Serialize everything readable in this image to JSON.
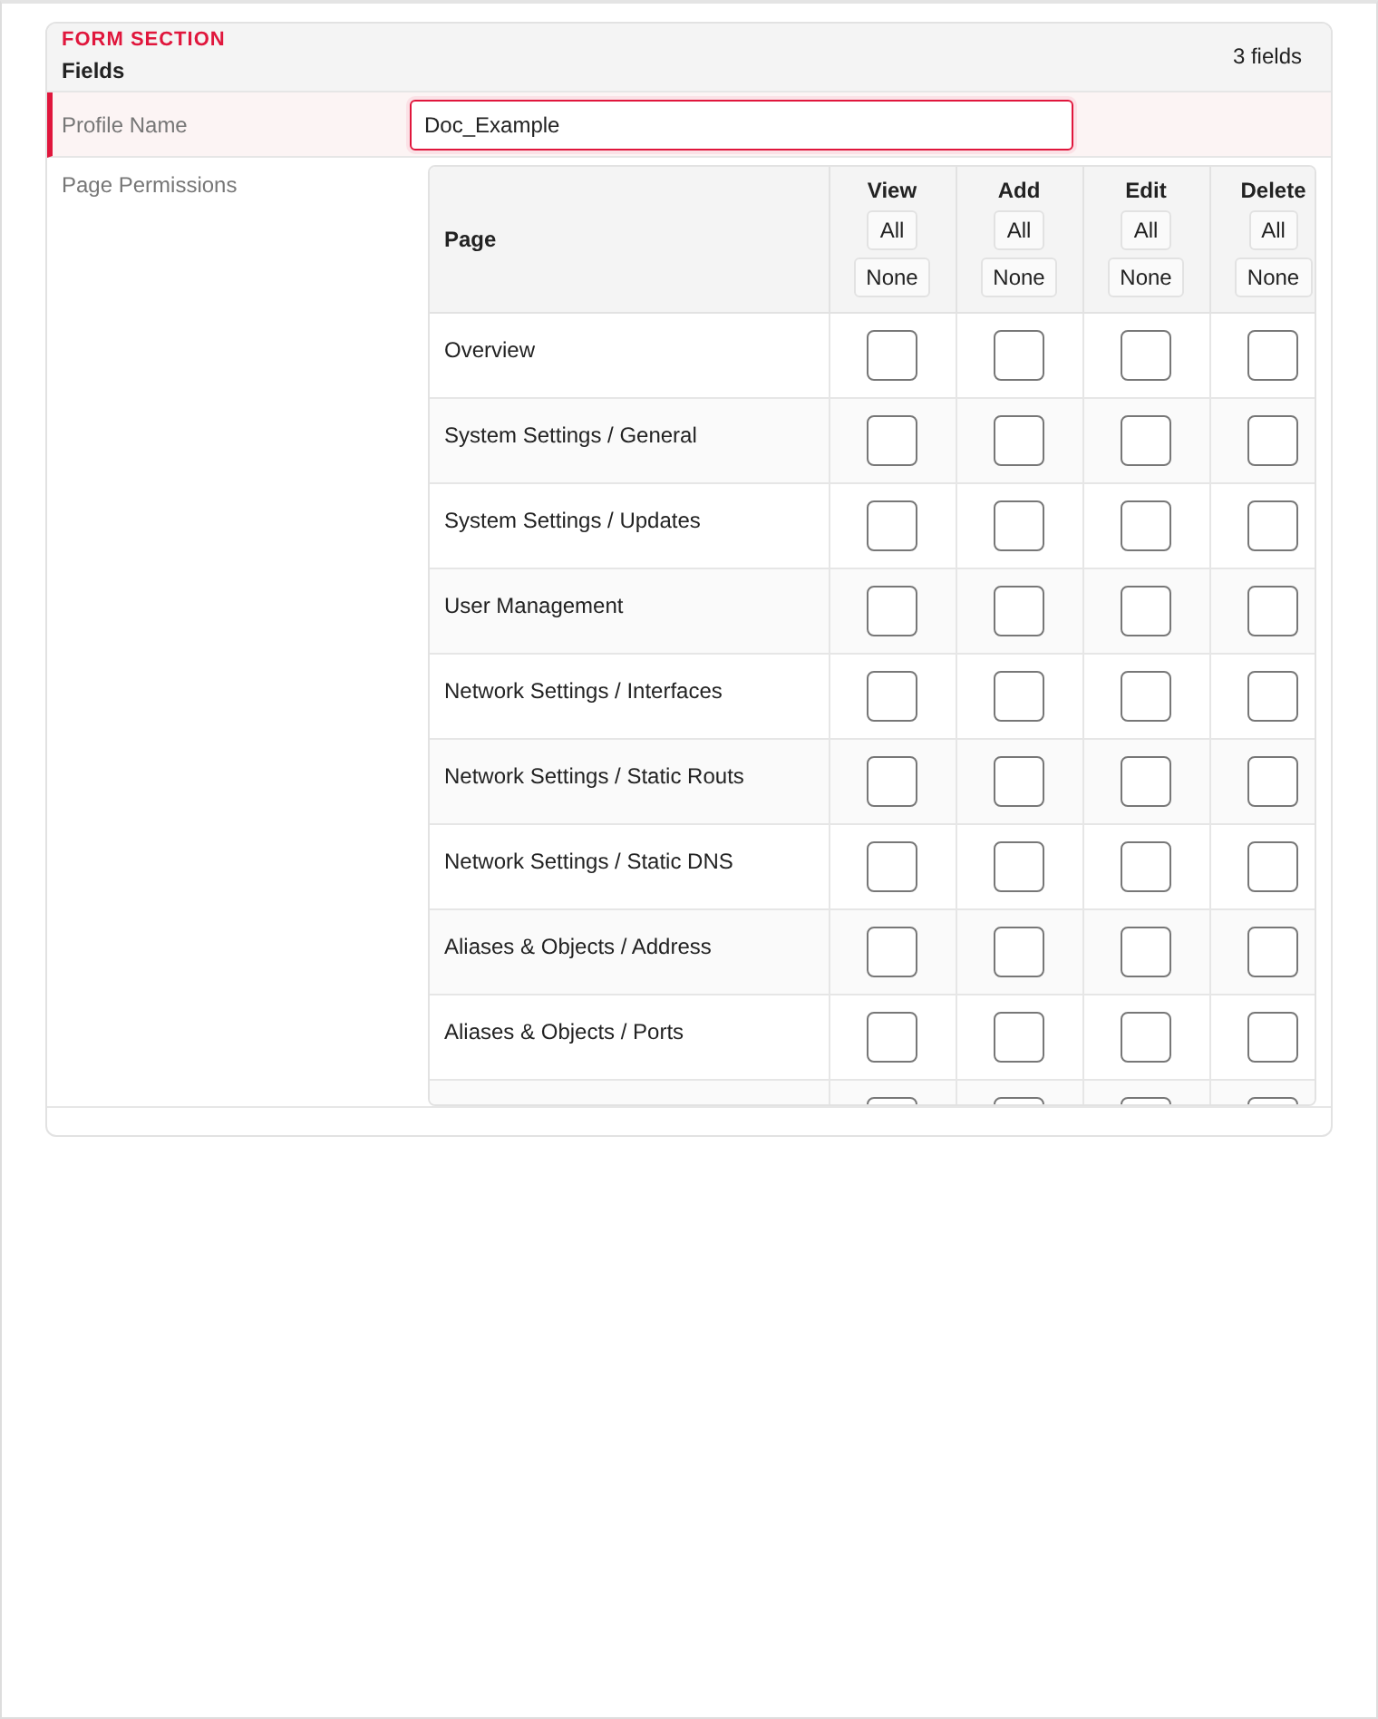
{
  "section": {
    "eyebrow": "FORM SECTION",
    "title": "Fields",
    "count": "3 fields"
  },
  "profile_name": {
    "label": "Profile Name",
    "value": "Doc_Example",
    "invalid": true
  },
  "page_permissions": {
    "label": "Page Permissions",
    "columns": [
      {
        "label": "Page"
      },
      {
        "label": "View",
        "all": "All",
        "none": "None"
      },
      {
        "label": "Add",
        "all": "All",
        "none": "None"
      },
      {
        "label": "Edit",
        "all": "All",
        "none": "None"
      },
      {
        "label": "Delete",
        "all": "All",
        "none": "None"
      }
    ],
    "rows": [
      {
        "page": "Overview",
        "permissions": [
          {
            "checked": false
          },
          {
            "checked": false
          },
          {
            "checked": false
          },
          {
            "checked": false
          }
        ]
      },
      {
        "page": "System Settings / General",
        "permissions": [
          {
            "checked": false
          },
          {
            "checked": false
          },
          {
            "checked": false
          },
          {
            "checked": false
          }
        ]
      },
      {
        "page": "System Settings / Updates",
        "permissions": [
          {
            "checked": false
          },
          {
            "checked": false
          },
          {
            "checked": false
          },
          {
            "checked": false
          }
        ]
      },
      {
        "page": "User Management",
        "permissions": [
          {
            "checked": false
          },
          {
            "checked": false
          },
          {
            "checked": false
          },
          {
            "checked": false
          }
        ]
      },
      {
        "page": "Network Settings / Interfaces",
        "permissions": [
          {
            "checked": false
          },
          {
            "checked": false
          },
          {
            "checked": false
          },
          {
            "checked": false
          }
        ]
      },
      {
        "page": "Network Settings / Static Routs",
        "permissions": [
          {
            "checked": false
          },
          {
            "checked": false
          },
          {
            "checked": false
          },
          {
            "checked": false
          }
        ]
      },
      {
        "page": "Network Settings / Static DNS",
        "permissions": [
          {
            "checked": false
          },
          {
            "checked": false
          },
          {
            "checked": false
          },
          {
            "checked": false
          }
        ]
      },
      {
        "page": "Aliases & Objects / Address",
        "permissions": [
          {
            "checked": false
          },
          {
            "checked": false
          },
          {
            "checked": false
          },
          {
            "checked": false
          }
        ]
      },
      {
        "page": "Aliases & Objects / Ports",
        "permissions": [
          {
            "checked": false
          },
          {
            "checked": false
          },
          {
            "checked": false
          },
          {
            "checked": false
          }
        ]
      },
      {
        "permissions": [
          {
            "checked": false
          },
          {
            "checked": false
          },
          {
            "checked": false
          },
          {
            "checked": false
          }
        ]
      }
    ]
  }
}
